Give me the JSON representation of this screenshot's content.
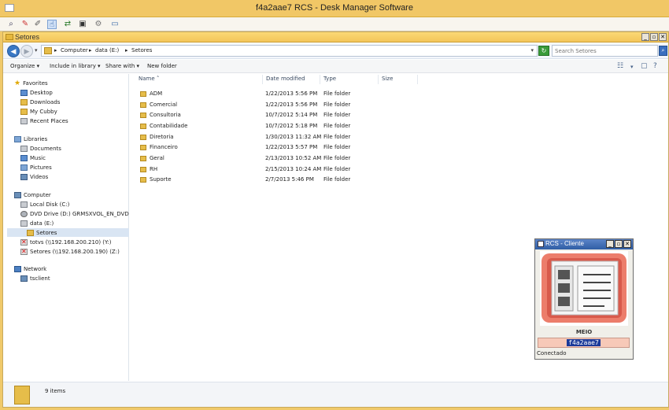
{
  "app": {
    "title": "f4a2aae7 RCS - Desk Manager Software"
  },
  "rcs_toolbar": {
    "tools": [
      "search-tool-icon",
      "pin-tool-icon",
      "edit-tool-icon",
      "pointer-tool-icon",
      "transfer-tool-icon",
      "device-tool-icon",
      "settings-tool-icon",
      "screen-tool-icon"
    ]
  },
  "explorer": {
    "window_title": "Setores",
    "mdi_buttons": {
      "minimize": "_",
      "restore": "▫",
      "close": "✕"
    },
    "address": {
      "breadcrumb": [
        "Computer",
        "data (E:)",
        "Setores"
      ],
      "separator": "▸"
    },
    "search": {
      "placeholder": "Search Setores"
    },
    "commands": {
      "organize": "Organize ▾",
      "include": "Include in library ▾",
      "share": "Share with ▾",
      "new_folder": "New folder"
    },
    "nav": {
      "favorites_header": "Favorites",
      "favorites": [
        "Desktop",
        "Downloads",
        "My Cubby",
        "Recent Places"
      ],
      "libraries_header": "Libraries",
      "libraries": [
        "Documents",
        "Music",
        "Pictures",
        "Videos"
      ],
      "computer_header": "Computer",
      "computer": [
        "Local Disk (C:)",
        "DVD Drive (D:) GRMSXVOL_EN_DVD",
        "data (E:)",
        "Setores",
        "totvs (\\\\192.168.200.210) (Y:)",
        "Setores (\\\\192.168.200.190) (Z:)"
      ],
      "network_header": "Network",
      "network": [
        "tsclient"
      ]
    },
    "columns": {
      "name": "Name",
      "date": "Date modified",
      "type": "Type",
      "size": "Size"
    },
    "files": [
      {
        "name": "ADM",
        "date": "1/22/2013 5:56 PM",
        "type": "File folder"
      },
      {
        "name": "Comercial",
        "date": "1/22/2013 5:56 PM",
        "type": "File folder"
      },
      {
        "name": "Consultoria",
        "date": "10/7/2012 5:14 PM",
        "type": "File folder"
      },
      {
        "name": "Contabilidade",
        "date": "10/7/2012 5:18 PM",
        "type": "File folder"
      },
      {
        "name": "Diretoria",
        "date": "1/30/2013 11:32 AM",
        "type": "File folder"
      },
      {
        "name": "Financeiro",
        "date": "1/22/2013 5:57 PM",
        "type": "File folder"
      },
      {
        "name": "Geral",
        "date": "2/13/2013 10:52 AM",
        "type": "File folder"
      },
      {
        "name": "RH",
        "date": "2/15/2013 10:24 AM",
        "type": "File folder"
      },
      {
        "name": "Suporte",
        "date": "2/7/2013 5:46 PM",
        "type": "File folder"
      }
    ],
    "status": {
      "items": "9 items"
    }
  },
  "rcs_client": {
    "title": "RCS - Cliente",
    "label": "MEIO",
    "id": "f4a2aae7",
    "status": "Conectado",
    "colors": {
      "accent": "#ec7d6b",
      "id_bg": "#1b3a9a"
    }
  }
}
